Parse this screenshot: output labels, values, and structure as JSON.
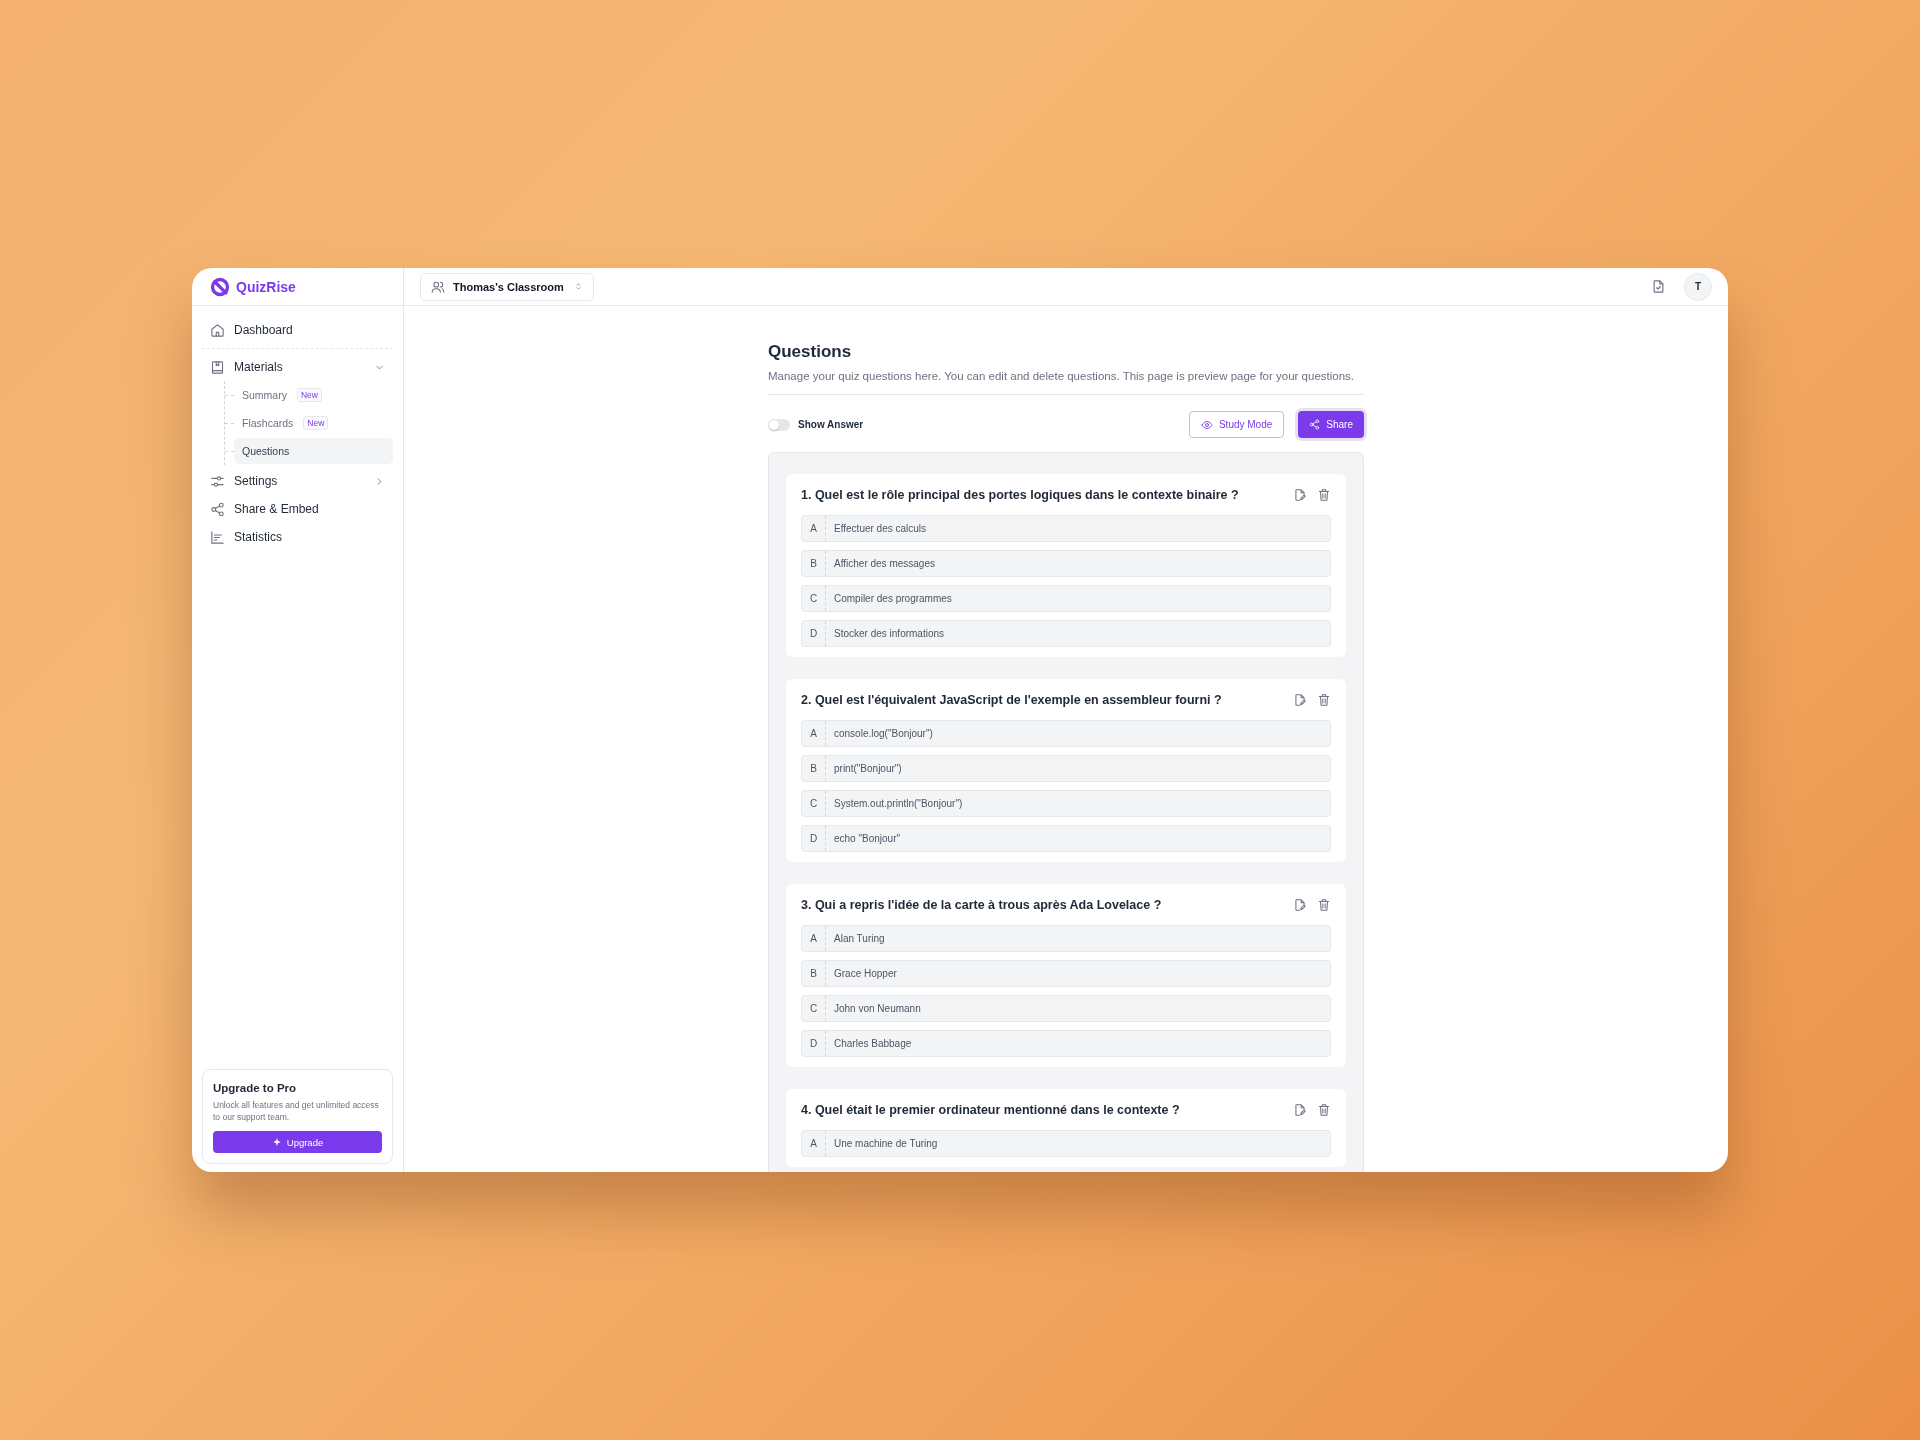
{
  "logo": {
    "name": "QuizRise"
  },
  "header": {
    "classroom": "Thomas's Classroom",
    "avatar": "T"
  },
  "sidebar": {
    "items": [
      {
        "kind": "home",
        "label": "Dashboard",
        "selected": false
      },
      {
        "kind": "book",
        "label": "Materials",
        "selected": false,
        "expanded": true,
        "children": [
          {
            "label": "Summary",
            "badge": "New",
            "selected": false
          },
          {
            "label": "Flashcards",
            "badge": "New",
            "selected": false
          },
          {
            "label": "Questions",
            "selected": true
          }
        ]
      },
      {
        "kind": "sliders",
        "label": "Settings",
        "selected": false,
        "expanded": false
      },
      {
        "kind": "share",
        "label": "Share & Embed",
        "selected": false
      },
      {
        "kind": "chart",
        "label": "Statistics",
        "selected": false
      }
    ],
    "upgrade": {
      "title": "Upgrade to Pro",
      "text": "Unlock all features and get unlimited access to our support team.",
      "button": "Upgrade"
    }
  },
  "page": {
    "title": "Questions",
    "description": "Manage your quiz questions here. You can edit and delete questions. This page is preview page for your questions.",
    "show_answer": {
      "label": "Show Answer",
      "on": false
    },
    "buttons": [
      {
        "kind": "outline",
        "label": "Study Mode"
      },
      {
        "kind": "primary",
        "label": "Share"
      }
    ]
  },
  "questions": [
    {
      "title": "1. Quel est le rôle principal des portes logiques dans le contexte binaire ?",
      "options": [
        {
          "letter": "A",
          "text": "Effectuer des calculs"
        },
        {
          "letter": "B",
          "text": "Afficher des messages"
        },
        {
          "letter": "C",
          "text": "Compiler des programmes"
        },
        {
          "letter": "D",
          "text": "Stocker des informations"
        }
      ]
    },
    {
      "title": "2. Quel est l'équivalent JavaScript de l'exemple en assembleur fourni ?",
      "options": [
        {
          "letter": "A",
          "text": "console.log(\"Bonjour\")"
        },
        {
          "letter": "B",
          "text": "print(\"Bonjour\")"
        },
        {
          "letter": "C",
          "text": "System.out.println(\"Bonjour\")"
        },
        {
          "letter": "D",
          "text": "echo \"Bonjour\""
        }
      ]
    },
    {
      "title": "3. Qui a repris l'idée de la carte à trous après Ada Lovelace ?",
      "options": [
        {
          "letter": "A",
          "text": "Alan Turing"
        },
        {
          "letter": "B",
          "text": "Grace Hopper"
        },
        {
          "letter": "C",
          "text": "John von Neumann"
        },
        {
          "letter": "D",
          "text": "Charles Babbage"
        }
      ]
    },
    {
      "title": "4. Quel était le premier ordinateur mentionné dans le contexte ?",
      "options": [
        {
          "letter": "A",
          "text": "Une machine de Turing"
        }
      ]
    }
  ]
}
